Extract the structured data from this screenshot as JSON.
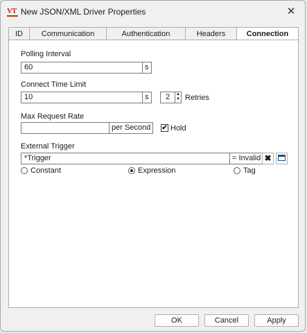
{
  "window": {
    "title": "New JSON/XML Driver Properties",
    "logo_text": "VT",
    "close_glyph": "✕"
  },
  "tabs": [
    {
      "label": "ID"
    },
    {
      "label": "Communication"
    },
    {
      "label": "Authentication"
    },
    {
      "label": "Headers"
    },
    {
      "label": "Connection",
      "active": true
    }
  ],
  "connection": {
    "polling_interval": {
      "label": "Polling Interval",
      "value": "60",
      "unit": "s"
    },
    "connect_time_limit": {
      "label": "Connect Time Limit",
      "value": "10",
      "unit": "s",
      "retries_value": "2",
      "retries_label": "Retries"
    },
    "max_request_rate": {
      "label": "Max Request Rate",
      "value": "",
      "unit": "per Second",
      "hold_label": "Hold",
      "hold_checked": true
    },
    "external_trigger": {
      "label": "External Trigger",
      "value": "*Trigger",
      "status": "= Invalid",
      "clear_glyph": "✖",
      "options": [
        {
          "label": "Constant",
          "selected": false
        },
        {
          "label": "Expression",
          "selected": true
        },
        {
          "label": "Tag",
          "selected": false
        }
      ]
    }
  },
  "buttons": {
    "ok": "OK",
    "cancel": "Cancel",
    "apply": "Apply"
  },
  "colors": {
    "logo": "#c42b1c",
    "window_bg": "#f0f0f0",
    "panel_bg": "#ffffff",
    "border": "#adadad"
  },
  "icons": {
    "spin_up": "▲",
    "spin_down": "▼",
    "check": "✔"
  }
}
